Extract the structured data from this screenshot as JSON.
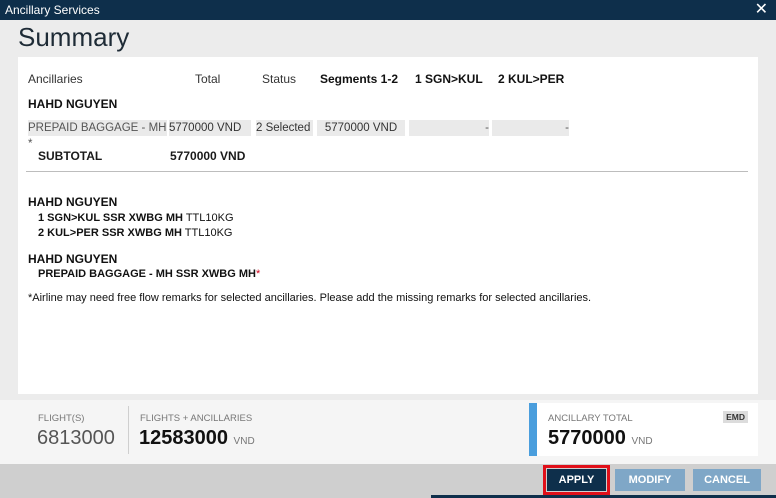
{
  "window": {
    "title": "Ancillary Services",
    "close_icon": "close-icon"
  },
  "heading": "Summary",
  "table": {
    "headers": {
      "ancillaries": "Ancillaries",
      "total": "Total",
      "status": "Status",
      "segments": "Segments 1-2",
      "seg1": "1 SGN>KUL",
      "seg2": "2 KUL>PER"
    },
    "passenger": "HAHD NGUYEN",
    "row": {
      "name": "PREPAID BAGGAGE - MH *",
      "total": "5770000 VND",
      "status": "2 Selected",
      "segments": "5770000 VND",
      "seg1": "-",
      "seg2": "-"
    },
    "subtotal_label": "SUBTOTAL",
    "subtotal_value": "5770000 VND"
  },
  "remarks": {
    "pax1": "HAHD NGUYEN",
    "line1_bold": "1 SGN>KUL SSR XWBG MH",
    "line1_text": "TTL10KG",
    "line2_bold": "2 KUL>PER SSR XWBG MH",
    "line2_text": "TTL10KG",
    "pax2": "HAHD NGUYEN",
    "line3_bold": "PREPAID BAGGAGE - MH SSR XWBG MH",
    "line3_star": "*",
    "note": "*Airline may need free flow remarks for selected ancillaries. Please add the missing remarks for selected ancillaries."
  },
  "totals": {
    "flights_label": "FLIGHT(S)",
    "flights_value": "6813000",
    "fa_label": "FLIGHTS + ANCILLARIES",
    "fa_value": "12583000",
    "fa_unit": "VND",
    "anc_label": "ANCILLARY TOTAL",
    "anc_value": "5770000",
    "anc_unit": "VND",
    "emd": "EMD"
  },
  "buttons": {
    "apply": "APPLY",
    "modify": "MODIFY",
    "cancel": "CANCEL"
  },
  "colors": {
    "titlebar": "#0e2f4b",
    "accent": "#4a9edd",
    "highlight": "#e0101a"
  }
}
